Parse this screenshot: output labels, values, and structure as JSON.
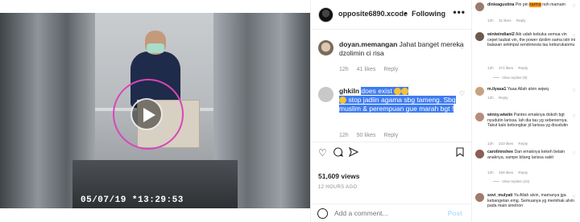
{
  "video": {
    "timestamp": "05/07/19 *13:29:53"
  },
  "header": {
    "username": "opposite6890.xcode",
    "separator": "•",
    "follow_label": "Following",
    "more_label": "•••"
  },
  "comments": [
    {
      "username": "doyan.memangan",
      "text": "Jahat banget mereka dzolimin ci risa",
      "time": "12h",
      "likes": "41 likes",
      "reply": "Reply"
    },
    {
      "username": "ghkiln",
      "text": "does exist",
      "text2": "stop jadiin agama sbg tameng. Sbq muslim & perempuan gue marah bgt !",
      "time": "12h",
      "likes": "50 likes",
      "reply": "Reply"
    }
  ],
  "post": {
    "views": "51,609 views",
    "ago": "12 HOURS AGO"
  },
  "add_comment": {
    "placeholder": "Add a comment...",
    "post_label": "Post"
  },
  "mobile_comments": [
    {
      "username": "dinieagustina",
      "text_before": "Pin pin ",
      "highlight": "karma",
      "text_after": " noh mamam",
      "time": "12h",
      "likes": "31 likes",
      "reply": "Reply"
    },
    {
      "username": "winiwindiani2",
      "text": "Aib udah kebuka semua vin cepet taubat vin, the power dzolim sama istri ini balasan setimpal sendonesia tau keburukanmu",
      "time": "12h",
      "likes": "372 likes",
      "reply": "Reply",
      "view_replies": "View replies (9)"
    },
    {
      "username": "m.ilyasa1",
      "text": "Yaaa Allah alvin wqwq",
      "time": "12h",
      "likes": "",
      "reply": "Reply"
    },
    {
      "username": "winny.wiwiin",
      "text": "Pantes emaknya dokoh bgt nyudutin larissa. lah dia tau yg sebenernya. Takut kalo kebongkar jd larissa yg disudutin",
      "time": "12h",
      "likes": "233 likes",
      "reply": "Reply"
    },
    {
      "username": "carolinnshee",
      "text": "Dan emaknya kekeh belain anaknya, sampe bilang larissa sakit",
      "time": "12h",
      "likes": "159 likes",
      "reply": "Reply",
      "view_replies": "View replies (10)"
    },
    {
      "username": "sovi_mulyati",
      "text": "Ya Allah alvin, mamanya jga kebangetan emg. Semuanya yg memihak alvin pada main sinetron",
      "time": "",
      "likes": "",
      "reply": ""
    }
  ],
  "colors": {
    "selection": "#3e7cf0",
    "karma_highlight": "#ff9800",
    "play_ring": "#d946b8",
    "post_button": "#b2dffc"
  },
  "icons": [
    "play-icon",
    "heart-icon",
    "comment-icon",
    "share-icon",
    "bookmark-icon",
    "smile-icon",
    "more-icon"
  ]
}
